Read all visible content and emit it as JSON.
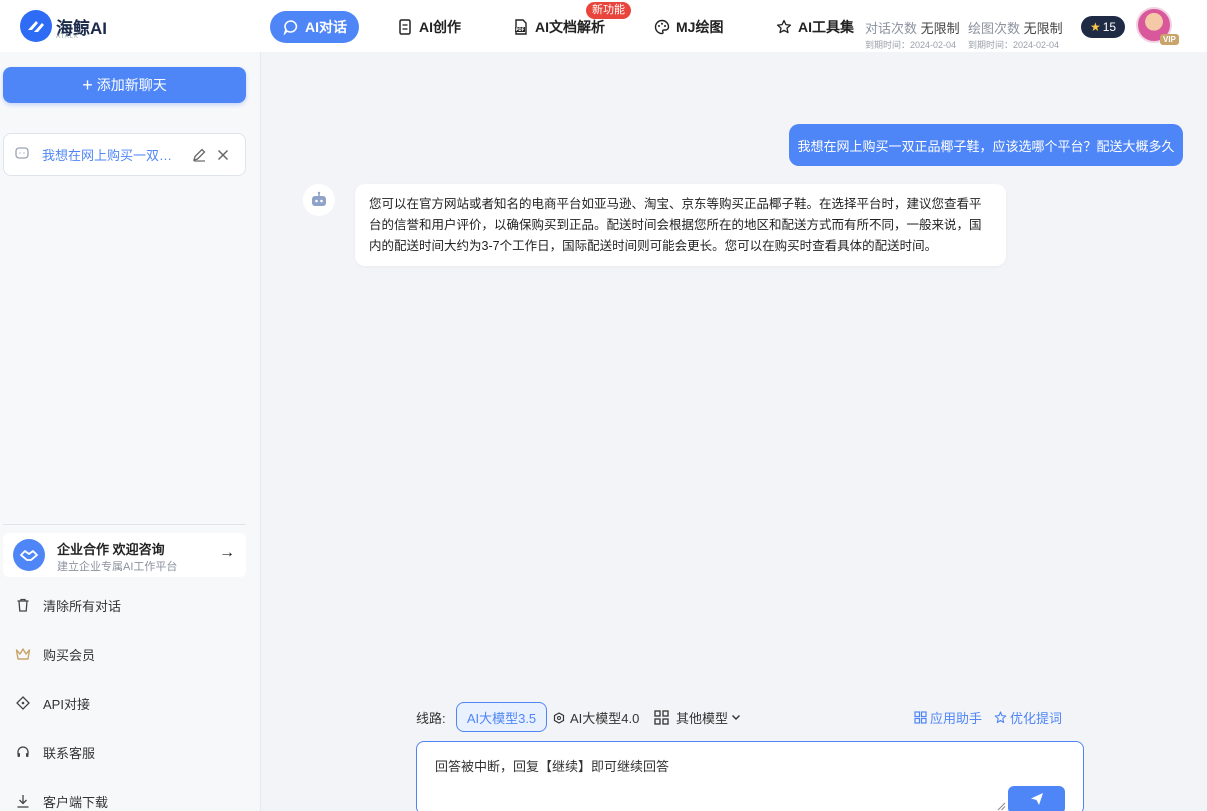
{
  "header": {
    "logo_text": "海鲸AI",
    "logo_sub": "ATALK",
    "nav": [
      {
        "label": "AI对话",
        "icon": "chat-icon",
        "active": true
      },
      {
        "label": "AI创作",
        "icon": "document-edit-icon",
        "active": false
      },
      {
        "label": "AI文档解析",
        "icon": "pdf-icon",
        "active": false
      },
      {
        "label": "MJ绘图",
        "icon": "palette-icon",
        "active": false
      },
      {
        "label": "AI工具集",
        "icon": "star-outline-icon",
        "active": false
      }
    ],
    "new_badge": "新功能",
    "quota_chat_label": "对话次数",
    "quota_chat_value": "无限制",
    "quota_chat_expire": "到期时间：2024-02-04",
    "quota_draw_label": "绘图次数",
    "quota_draw_value": "无限制",
    "quota_draw_expire": "到期时间：2024-02-04",
    "stars": "15",
    "vip": "VIP"
  },
  "sidebar": {
    "new_chat_label": "添加新聊天",
    "chats": [
      {
        "title": "我想在网上购买一双正品椰子鞋，应该选哪个平台？配送大概多久"
      }
    ],
    "enterprise_title": "企业合作 欢迎咨询",
    "enterprise_sub": "建立企业专属AI工作平台",
    "links": [
      {
        "label": "清除所有对话",
        "icon": "trash-icon"
      },
      {
        "label": "购买会员",
        "icon": "crown-icon"
      },
      {
        "label": "API对接",
        "icon": "api-icon"
      },
      {
        "label": "联系客服",
        "icon": "headset-icon"
      },
      {
        "label": "客户端下载",
        "icon": "download-icon"
      }
    ]
  },
  "conversation": {
    "user_message": "我想在网上购买一双正品椰子鞋，应该选哪个平台？配送大概多久",
    "bot_message": "您可以在官方网站或者知名的电商平台如亚马逊、淘宝、京东等购买正品椰子鞋。在选择平台时，建议您查看平台的信誉和用户评价，以确保购买到正品。配送时间会根据您所在的地区和配送方式而有所不同，一般来说，国内的配送时间大约为3-7个工作日，国际配送时间则可能会更长。您可以在购买时查看具体的配送时间。"
  },
  "composer": {
    "route_label": "线路:",
    "models": [
      {
        "label": "AI大模型3.5",
        "active": true
      },
      {
        "label": "AI大模型4.0",
        "icon": "hexagon-icon",
        "active": false
      },
      {
        "label": "其他模型",
        "icon": "grid-icon",
        "active": false
      }
    ],
    "app_helper": "应用助手",
    "optimize_prompt": "优化提词",
    "placeholder": "回答被中断，回复【继续】即可继续回答"
  },
  "colors": {
    "accent": "#4f86f7",
    "badge_red": "#e8453c",
    "dark_pill": "#1f2a44"
  }
}
